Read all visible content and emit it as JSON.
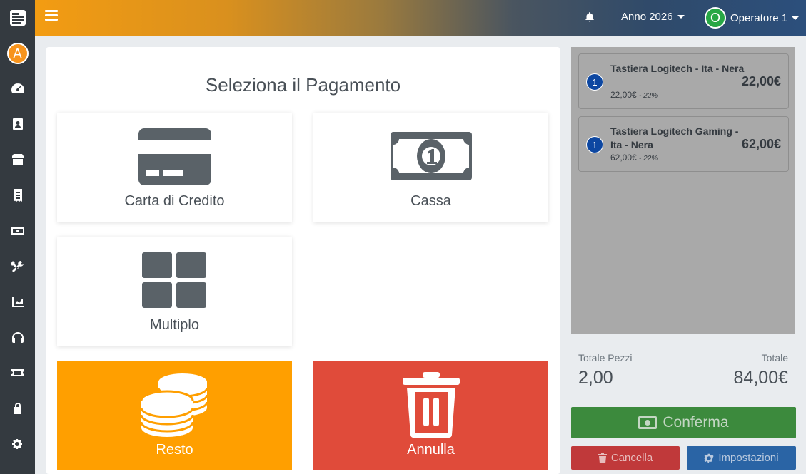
{
  "topbar": {
    "year_label": "Anno 2026",
    "operator_label": "Operatore 1",
    "operator_initial": "O"
  },
  "sidebar": {
    "avatar_initial": "A",
    "items": [
      "logo-icon",
      "dashboard-icon",
      "contacts-icon",
      "store-icon",
      "receipt-icon",
      "money-icon",
      "tools-icon",
      "chart-icon",
      "headset-icon",
      "ticket-icon",
      "lock-icon",
      "settings-icon"
    ]
  },
  "main": {
    "title": "Seleziona il Pagamento",
    "payment_methods": [
      {
        "label": "Carta di Credito",
        "icon": "credit-card-icon"
      },
      {
        "label": "Cassa",
        "icon": "cash-icon"
      },
      {
        "label": "Multiplo",
        "icon": "grid-icon"
      }
    ],
    "actions": [
      {
        "label": "Resto",
        "icon": "coins-icon",
        "color": "#ff9f00"
      },
      {
        "label": "Annulla",
        "icon": "trash-icon",
        "color": "#e04b3a"
      }
    ]
  },
  "cart": {
    "items": [
      {
        "qty": "1",
        "name": "Tastiera Logitech - Ita - Nera",
        "unit_price": "22,00€",
        "vat": "- 22%",
        "total": "22,00€"
      },
      {
        "qty": "1",
        "name": "Tastiera Logitech Gaming - Ita - Nera",
        "unit_price": "62,00€",
        "vat": "- 22%",
        "total": "62,00€"
      }
    ],
    "total_pieces_label": "Totale Pezzi",
    "total_pieces": "2,00",
    "total_label": "Totale",
    "total_value": "84,00€"
  },
  "buttons": {
    "confirm": "Conferma",
    "cancel": "Cancella",
    "settings": "Impostazioni"
  }
}
